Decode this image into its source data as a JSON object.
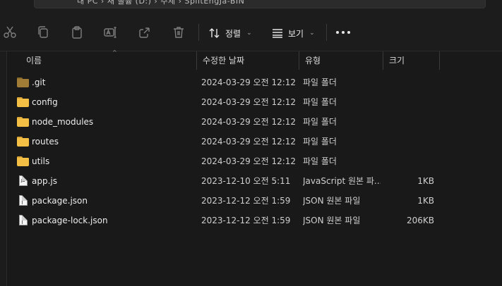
{
  "addressbar": {
    "crumbs": "내 PC  ›  새 볼륨 (D:)  ›  주제  ›  SplitEngJa-BIN"
  },
  "toolbar": {
    "buttons": [
      {
        "name": "cut",
        "icon": "scissors-icon"
      },
      {
        "name": "copy",
        "icon": "copy-icon"
      },
      {
        "name": "paste",
        "icon": "clipboard-icon"
      },
      {
        "name": "rename",
        "icon": "rename-icon"
      },
      {
        "name": "share",
        "icon": "share-icon"
      },
      {
        "name": "delete",
        "icon": "trash-icon"
      }
    ],
    "sort_label": "정렬",
    "view_label": "보기",
    "chevron": "⌄"
  },
  "columns": {
    "name": "이름",
    "date": "수정한 날짜",
    "type": "유형",
    "size": "크기",
    "sort_caret": "^"
  },
  "files": [
    {
      "name": ".git",
      "date": "2024-03-29 오전 12:12",
      "type": "파일 폴더",
      "size": "",
      "kind": "folder-hidden"
    },
    {
      "name": "config",
      "date": "2024-03-29 오전 12:12",
      "type": "파일 폴더",
      "size": "",
      "kind": "folder"
    },
    {
      "name": "node_modules",
      "date": "2024-03-29 오전 12:12",
      "type": "파일 폴더",
      "size": "",
      "kind": "folder"
    },
    {
      "name": "routes",
      "date": "2024-03-29 오전 12:12",
      "type": "파일 폴더",
      "size": "",
      "kind": "folder"
    },
    {
      "name": "utils",
      "date": "2024-03-29 오전 12:12",
      "type": "파일 폴더",
      "size": "",
      "kind": "folder"
    },
    {
      "name": "app.js",
      "date": "2023-12-10 오전 5:11",
      "type": "JavaScript 원본 파...",
      "size": "1KB",
      "kind": "js-file"
    },
    {
      "name": "package.json",
      "date": "2023-12-12 오전 1:59",
      "type": "JSON 원본 파일",
      "size": "1KB",
      "kind": "json-file"
    },
    {
      "name": "package-lock.json",
      "date": "2023-12-12 오전 1:59",
      "type": "JSON 원본 파일",
      "size": "206KB",
      "kind": "json-file"
    }
  ],
  "colors": {
    "background": "#191919",
    "folder": "#f3bf45",
    "folder_hidden": "#a07c36"
  }
}
